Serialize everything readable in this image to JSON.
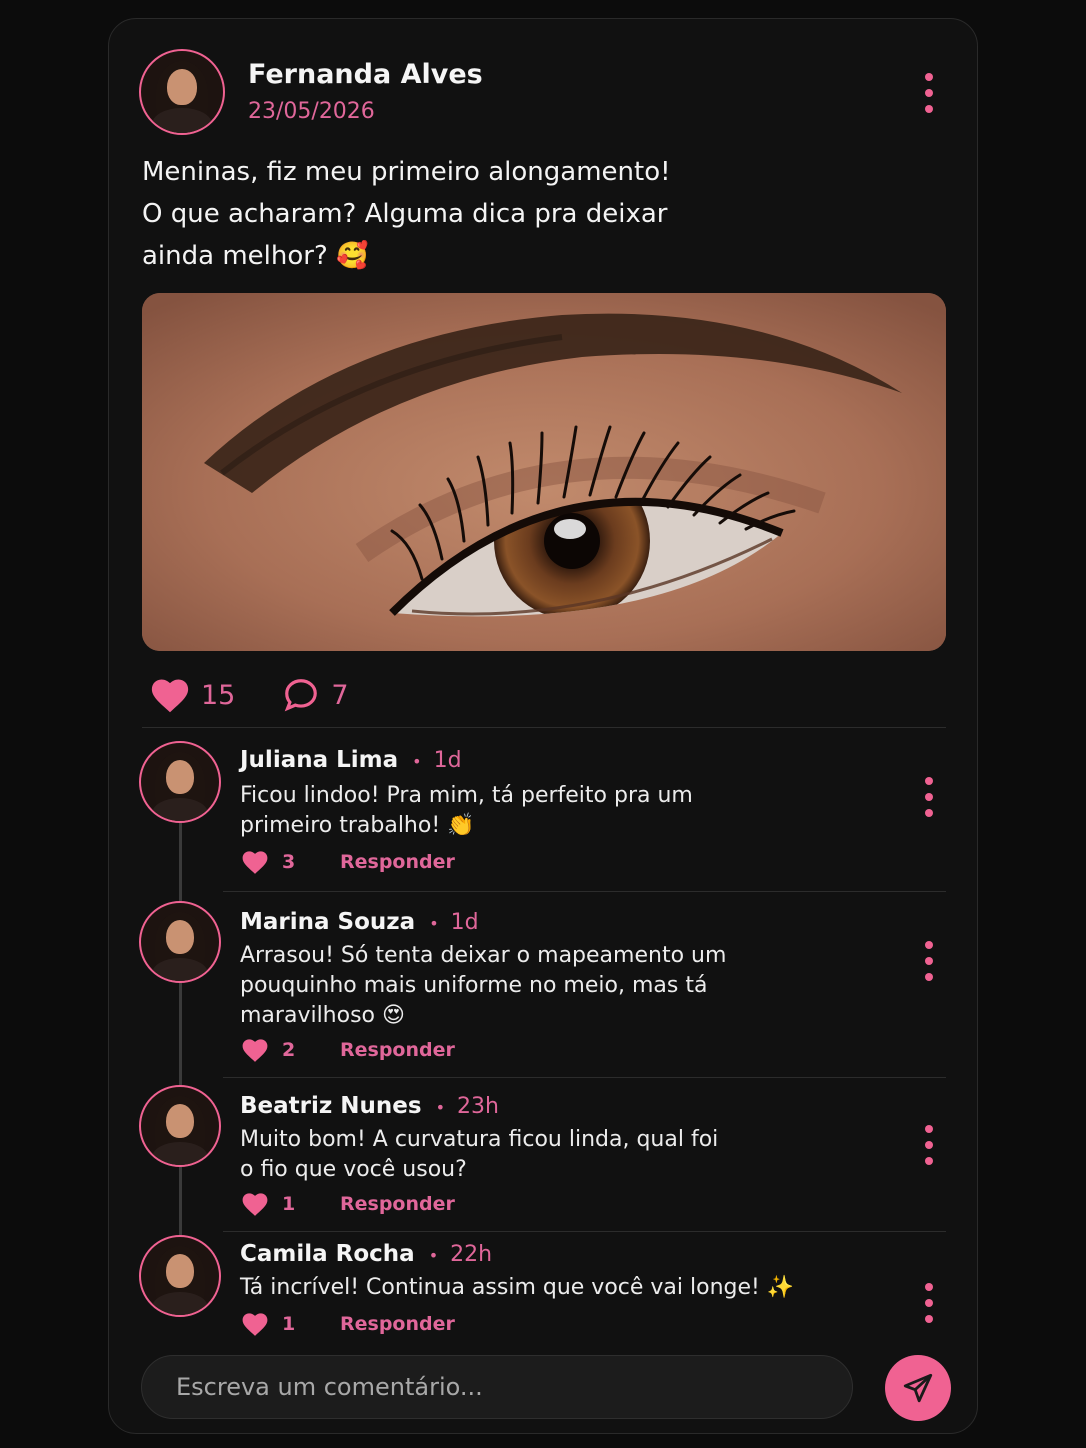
{
  "post": {
    "author": "Fernanda Alves",
    "date": "23/05/2026",
    "text_lines": [
      "Meninas, fiz meu primeiro alongamento!",
      "O que acharam? Alguma dica pra deixar",
      "ainda melhor? 🥰"
    ],
    "likes": "15",
    "comments": "7"
  },
  "comments": [
    {
      "name": "Juliana Lima",
      "time": "1d",
      "lines": [
        "Ficou lindoo! Pra mim, tá perfeito pra um",
        "primeiro trabalho! 👏"
      ],
      "likes": "3",
      "reply": "Responder"
    },
    {
      "name": "Marina Souza",
      "time": "1d",
      "lines": [
        "Arrasou! Só tenta deixar o mapeamento um",
        "pouquinho mais uniforme no meio, mas tá",
        "maravilhoso 😍"
      ],
      "likes": "2",
      "reply": "Responder"
    },
    {
      "name": "Beatriz Nunes",
      "time": "23h",
      "lines": [
        "Muito bom! A curvatura ficou linda, qual foi",
        "o fio que você usou?"
      ],
      "likes": "1",
      "reply": "Responder"
    },
    {
      "name": "Camila Rocha",
      "time": "22h",
      "lines": [
        "Tá incrível! Continua assim que você vai longe! ✨"
      ],
      "likes": "1",
      "reply": "Responder"
    }
  ],
  "composer": {
    "placeholder": "Escreva um comentário..."
  },
  "colors": {
    "accent": "#f06292",
    "background": "#0c0c0c",
    "card": "#111111"
  }
}
